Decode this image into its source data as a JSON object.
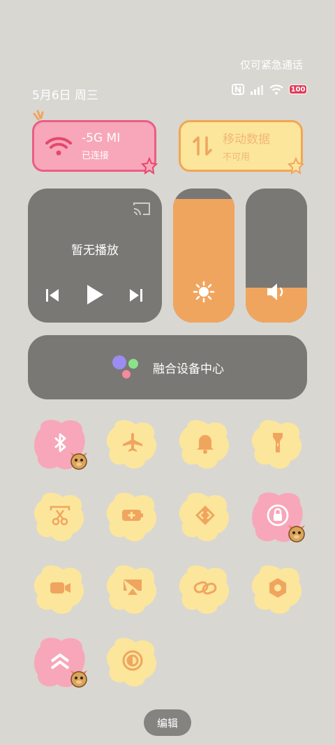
{
  "status": {
    "emergency_text": "仅可紧急通话",
    "date_text": "5月6日 周三",
    "battery_label": "100",
    "icons": [
      "nfc-icon",
      "signal-icon",
      "wifi-status-icon",
      "battery-icon"
    ]
  },
  "wifi_card": {
    "title": "-5G   MI",
    "subtitle": "已连接",
    "icon": "wifi-icon"
  },
  "data_card": {
    "title": "移动数据",
    "subtitle": "不可用",
    "icon": "mobile-data-icon"
  },
  "media": {
    "title": "暂无播放",
    "controls": [
      "previous-icon",
      "play-icon",
      "next-icon",
      "cast-icon"
    ]
  },
  "sliders": {
    "brightness": {
      "level": 0.92,
      "icon": "sun-icon"
    },
    "volume": {
      "level": 0.26,
      "icon": "speaker-icon"
    }
  },
  "device_center": {
    "label": "融合设备中心"
  },
  "tiles": [
    {
      "name": "bluetooth",
      "active": true
    },
    {
      "name": "airplane-mode",
      "active": false
    },
    {
      "name": "notification-bell",
      "active": false
    },
    {
      "name": "flashlight",
      "active": false
    },
    {
      "name": "screenshot",
      "active": false
    },
    {
      "name": "battery-saver",
      "active": false
    },
    {
      "name": "code-share",
      "active": false
    },
    {
      "name": "rotation-lock",
      "active": true
    },
    {
      "name": "screen-record",
      "active": false
    },
    {
      "name": "screen-cast",
      "active": false
    },
    {
      "name": "link",
      "active": false
    },
    {
      "name": "settings-hex",
      "active": false
    },
    {
      "name": "performance-mode",
      "active": true
    },
    {
      "name": "dark-mode",
      "active": false
    }
  ],
  "colors": {
    "pink": "#f7a7b9",
    "pink_icon": "#f3a3b4",
    "yellow": "#fbe69c",
    "orange": "#f0a55f",
    "dark_card": "#7a7874"
  },
  "edit_label": "编辑"
}
